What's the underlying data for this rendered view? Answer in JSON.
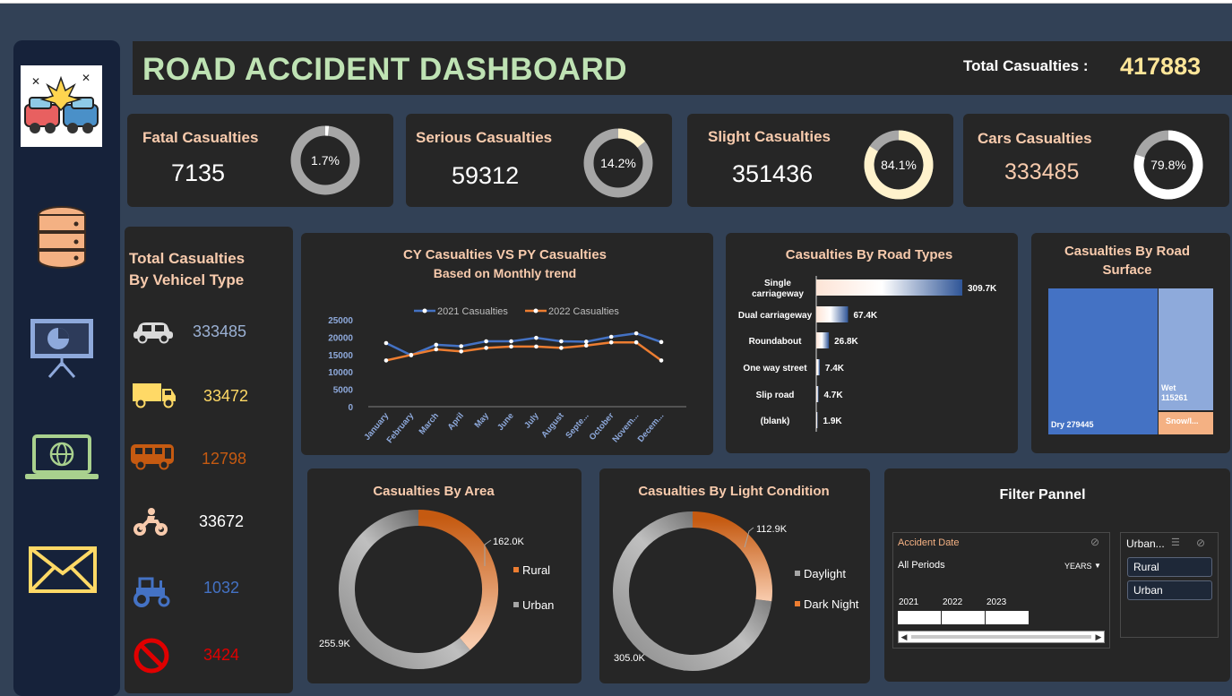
{
  "header": {
    "title": "ROAD ACCIDENT DASHBOARD",
    "total_label": "Total Casualties :",
    "total_value": "417883"
  },
  "kpis": [
    {
      "label": "Fatal Casualties",
      "value": "7135",
      "pct_label": "1.7%",
      "pct": 0.017,
      "color": "#ffffff"
    },
    {
      "label": "Serious Casualties",
      "value": "59312",
      "pct_label": "14.2%",
      "pct": 0.142,
      "color": "#fff2cc"
    },
    {
      "label": "Slight Casualties",
      "value": "351436",
      "pct_label": "84.1%",
      "pct": 0.841,
      "color": "#fff2cc"
    },
    {
      "label": "Cars Casualties",
      "value": "333485",
      "pct_label": "79.8%",
      "pct": 0.798,
      "color": "#ffffff"
    }
  ],
  "vehicle": {
    "title_line1": "Total Casualties",
    "title_line2": "By Vehicel Type",
    "items": [
      {
        "icon": "car-icon",
        "value": "333485",
        "color": "#9bb1d4"
      },
      {
        "icon": "truck-icon",
        "value": "33472",
        "color": "#ffd966"
      },
      {
        "icon": "bus-icon",
        "value": "12798",
        "color": "#c55a11"
      },
      {
        "icon": "motorcycle-icon",
        "value": "33672",
        "color": "#f8cbad"
      },
      {
        "icon": "tractor-icon",
        "value": "1032",
        "color": "#4472c4"
      },
      {
        "icon": "no-entry-icon",
        "value": "3424",
        "color": "#e00000"
      }
    ]
  },
  "chart_data": [
    {
      "type": "line",
      "title": "CY Casualties VS PY Casualties",
      "subtitle": "Based on Monthly trend",
      "categories": [
        "January",
        "February",
        "March",
        "April",
        "May",
        "June",
        "July",
        "August",
        "Septe...",
        "October",
        "Novem...",
        "Decem..."
      ],
      "series": [
        {
          "name": "2021 Casualties",
          "color": "#4472c4",
          "values": [
            18300,
            14800,
            17800,
            17400,
            18800,
            18800,
            19800,
            18800,
            18700,
            20100,
            21100,
            18600
          ]
        },
        {
          "name": "2022 Casualties",
          "color": "#ed7d31",
          "values": [
            13300,
            14900,
            16500,
            15900,
            16900,
            17300,
            17300,
            16900,
            17600,
            18500,
            18500,
            13300
          ]
        }
      ],
      "yticks": [
        "25000",
        "20000",
        "15000",
        "10000",
        "5000",
        "0"
      ],
      "ylim": [
        0,
        25000
      ]
    },
    {
      "type": "bar",
      "title": "Casualties By Road Types",
      "categories": [
        "Single carriageway",
        "Dual carriageway",
        "Roundabout",
        "One way street",
        "Slip road",
        "(blank)"
      ],
      "values": [
        309.7,
        67.4,
        26.8,
        7.4,
        4.7,
        1.9
      ],
      "labels": [
        "309.7K",
        "67.4K",
        "26.8K",
        "7.4K",
        "4.7K",
        "1.9K"
      ]
    },
    {
      "type": "heatmap",
      "title": "Casualties By Road Surface",
      "items": [
        {
          "label": "Dry 279445",
          "value": 279445,
          "color": "#4472c4"
        },
        {
          "label": "Wet 115261",
          "value": 115261,
          "color": "#8eaadb"
        },
        {
          "label": "Snow/I...",
          "color": "#f4b183"
        }
      ]
    },
    {
      "type": "pie",
      "title": "Casualties By Area",
      "slices": [
        {
          "name": "Rural",
          "value": 162.0,
          "label": "162.0K"
        },
        {
          "name": "Urban",
          "value": 255.9,
          "label": "255.9K"
        }
      ]
    },
    {
      "type": "pie",
      "title": "Casualties By Light Condition",
      "slices": [
        {
          "name": "Daylight",
          "value": 305.0,
          "label": "305.0K"
        },
        {
          "name": "Dark Night",
          "value": 112.9,
          "label": "112.9K"
        }
      ]
    }
  ],
  "filter": {
    "title": "Filter Pannel",
    "date_title": "Accident Date",
    "periods": "All Periods",
    "unit": "YEARS",
    "years": [
      "2021",
      "2022",
      "2023"
    ],
    "slicer_title": "Urban...",
    "options": [
      "Rural",
      "Urban"
    ]
  }
}
